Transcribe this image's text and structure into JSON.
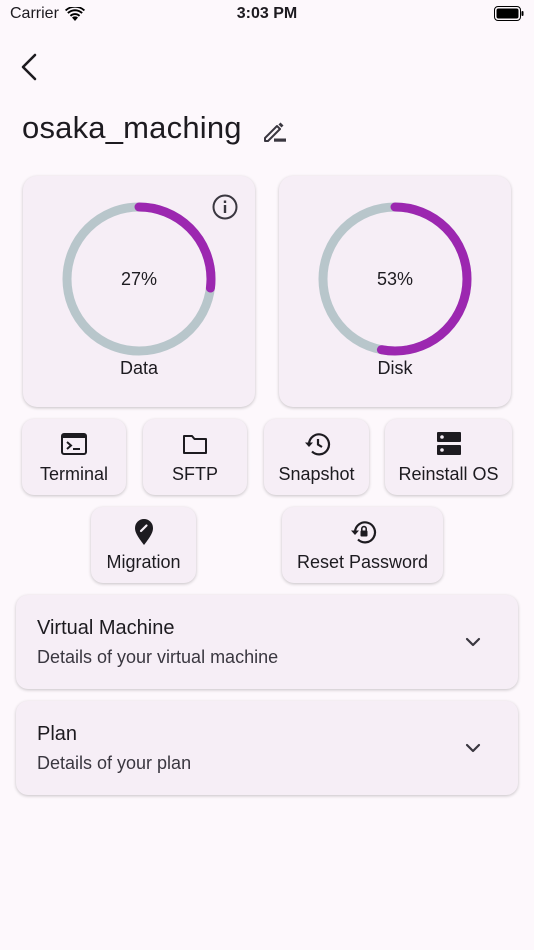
{
  "status_bar": {
    "carrier": "Carrier",
    "time": "3:03 PM"
  },
  "header": {
    "server_name": "osaka_maching"
  },
  "gauges": [
    {
      "label": "Data",
      "value_text": "27%",
      "percent": 27
    },
    {
      "label": "Disk",
      "value_text": "53%",
      "percent": 53
    }
  ],
  "actions": {
    "terminal": "Terminal",
    "sftp": "SFTP",
    "snapshot": "Snapshot",
    "reinstall": "Reinstall OS",
    "migration": "Migration",
    "reset_password": "Reset Password"
  },
  "panels": {
    "vm": {
      "title": "Virtual Machine",
      "subtitle": "Details of your virtual machine"
    },
    "plan": {
      "title": "Plan",
      "subtitle": "Details of your plan"
    }
  },
  "colors": {
    "accent": "#9c27b0",
    "track": "#b8c6cb",
    "card": "#f6eef6",
    "background": "#fdf8fc"
  },
  "icons": [
    "back-icon",
    "edit-icon",
    "info-icon",
    "terminal-icon",
    "folder-icon",
    "history-icon",
    "server-icon",
    "location-pin-icon",
    "lock-reset-icon",
    "chevron-down-icon",
    "wifi-icon",
    "battery-icon"
  ]
}
